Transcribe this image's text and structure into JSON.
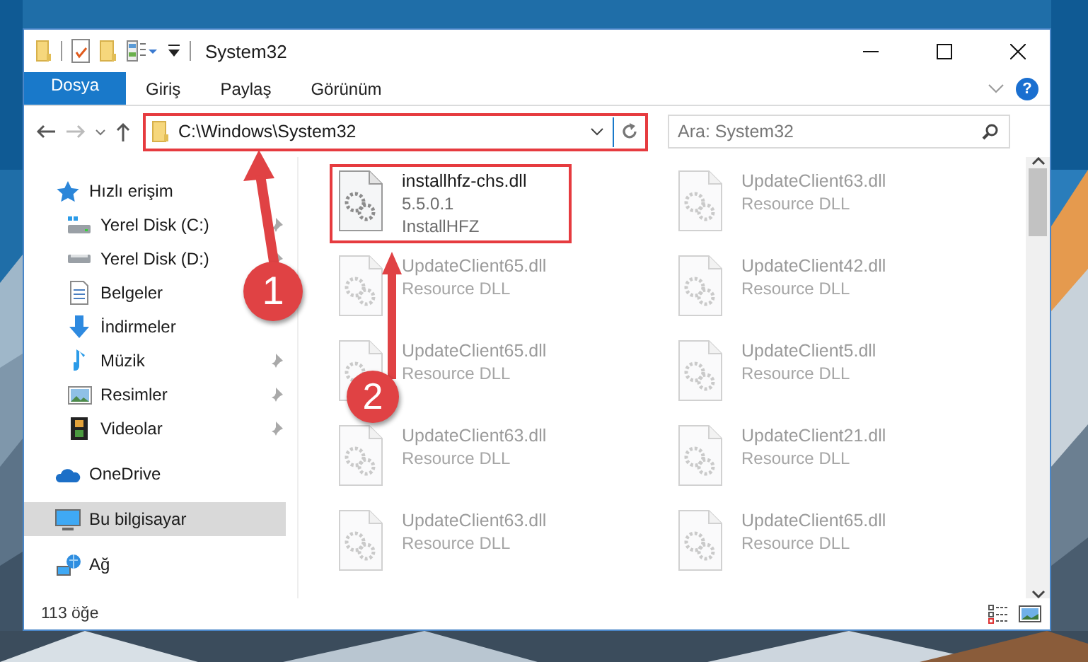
{
  "window": {
    "title": "System32"
  },
  "ribbon": {
    "tabs": [
      {
        "label": "Dosya",
        "kind": "file"
      },
      {
        "label": "Giriş",
        "kind": "tab"
      },
      {
        "label": "Paylaş",
        "kind": "tab"
      },
      {
        "label": "Görünüm",
        "kind": "tab"
      }
    ],
    "help": "?"
  },
  "address_bar": {
    "path": "C:\\Windows\\System32",
    "highlighted": true
  },
  "search": {
    "placeholder": "Ara: System32"
  },
  "sidebar": {
    "items": [
      {
        "label": "Hızlı erişim",
        "selected": false,
        "children": [
          {
            "label": "Yerel Disk (C:)",
            "pinned": true,
            "selected": false
          },
          {
            "label": "Yerel Disk (D:)",
            "pinned": true,
            "selected": false
          },
          {
            "label": "Belgeler",
            "pinned": false,
            "selected": false
          },
          {
            "label": "İndirmeler",
            "pinned": false,
            "selected": false
          },
          {
            "label": "Müzik",
            "pinned": true,
            "selected": false
          },
          {
            "label": "Resimler",
            "pinned": true,
            "selected": false
          },
          {
            "label": "Videolar",
            "pinned": true,
            "selected": false
          }
        ]
      },
      {
        "label": "OneDrive",
        "selected": false
      },
      {
        "label": "Bu bilgisayar",
        "selected": true
      },
      {
        "label": "Ağ",
        "selected": false
      }
    ]
  },
  "files": [
    {
      "name": "installhfz-chs.dll",
      "details": [
        "5.5.0.1",
        "InstallHFZ"
      ],
      "faded": false,
      "highlighted": true
    },
    {
      "name": "UpdateClient63.dll",
      "details": [
        "Resource DLL"
      ],
      "faded": true,
      "highlighted": false
    },
    {
      "name": "UpdateClient65.dll",
      "details": [
        "Resource DLL"
      ],
      "faded": true,
      "highlighted": false
    },
    {
      "name": "UpdateClient42.dll",
      "details": [
        "Resource DLL"
      ],
      "faded": true,
      "highlighted": false
    },
    {
      "name": "UpdateClient65.dll",
      "details": [
        "Resource DLL"
      ],
      "faded": true,
      "highlighted": false
    },
    {
      "name": "UpdateClient5.dll",
      "details": [
        "Resource DLL"
      ],
      "faded": true,
      "highlighted": false
    },
    {
      "name": "UpdateClient63.dll",
      "details": [
        "Resource DLL"
      ],
      "faded": true,
      "highlighted": false
    },
    {
      "name": "UpdateClient21.dll",
      "details": [
        "Resource DLL"
      ],
      "faded": true,
      "highlighted": false
    },
    {
      "name": "UpdateClient63.dll",
      "details": [
        "Resource DLL"
      ],
      "faded": true,
      "highlighted": false
    },
    {
      "name": "UpdateClient65.dll",
      "details": [
        "Resource DLL"
      ],
      "faded": true,
      "highlighted": false
    }
  ],
  "status_bar": {
    "count": "113 öğe"
  },
  "annotations": [
    {
      "number": "1"
    },
    {
      "number": "2"
    }
  ]
}
